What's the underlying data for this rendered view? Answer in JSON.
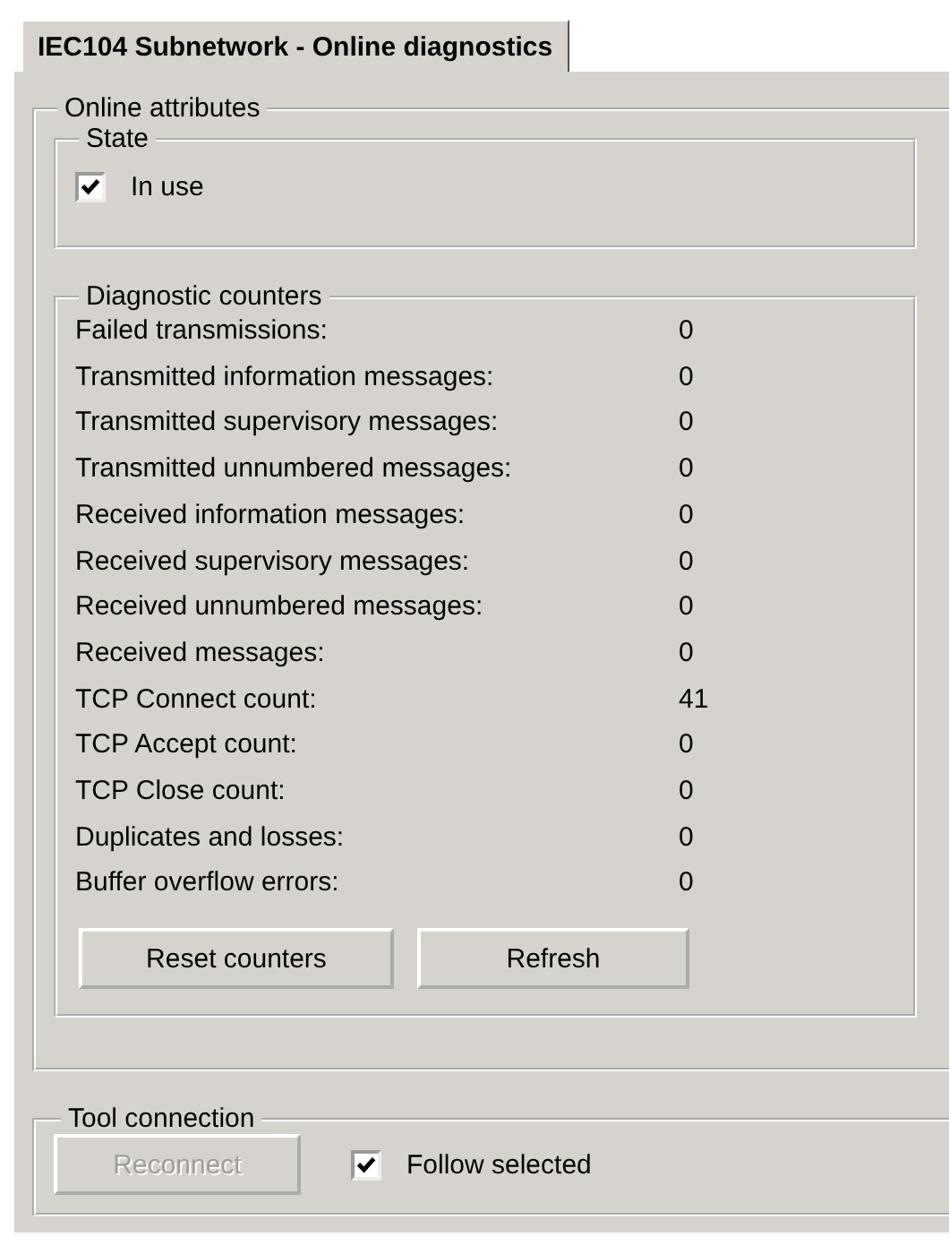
{
  "tab": {
    "title": "IEC104 Subnetwork - Online diagnostics",
    "selected": true
  },
  "online_attributes": {
    "title": "Online attributes",
    "state": {
      "title": "State",
      "checkbox": {
        "label": "In use",
        "checked": true
      }
    },
    "diagnostic_counters": {
      "title": "Diagnostic counters",
      "rows": [
        {
          "label": "Failed transmissions:",
          "value": "0"
        },
        {
          "label": "Transmitted information messages:",
          "value": "0"
        },
        {
          "label": "Transmitted supervisory messages:",
          "value": "0"
        },
        {
          "label": "Transmitted unnumbered messages:",
          "value": "0"
        },
        {
          "label": "Received information messages:",
          "value": "0"
        },
        {
          "label": "Received supervisory messages:",
          "value": "0"
        },
        {
          "label": "Received unnumbered messages:",
          "value": "0"
        },
        {
          "label": "Received messages:",
          "value": "0"
        },
        {
          "label": "TCP Connect count:",
          "value": "41"
        },
        {
          "label": "TCP Accept count:",
          "value": "0"
        },
        {
          "label": "TCP Close count:",
          "value": "0"
        },
        {
          "label": "Duplicates and losses:",
          "value": "0"
        },
        {
          "label": "Buffer overflow errors:",
          "value": "0"
        }
      ],
      "buttons": [
        {
          "label": "Reset counters",
          "disabled": false
        },
        {
          "label": "Refresh",
          "disabled": false
        }
      ]
    }
  },
  "tool_connection": {
    "title": "Tool connection",
    "button": {
      "label": "Reconnect",
      "disabled": true
    },
    "checkbox": {
      "label": "Follow selected",
      "checked": true
    }
  }
}
